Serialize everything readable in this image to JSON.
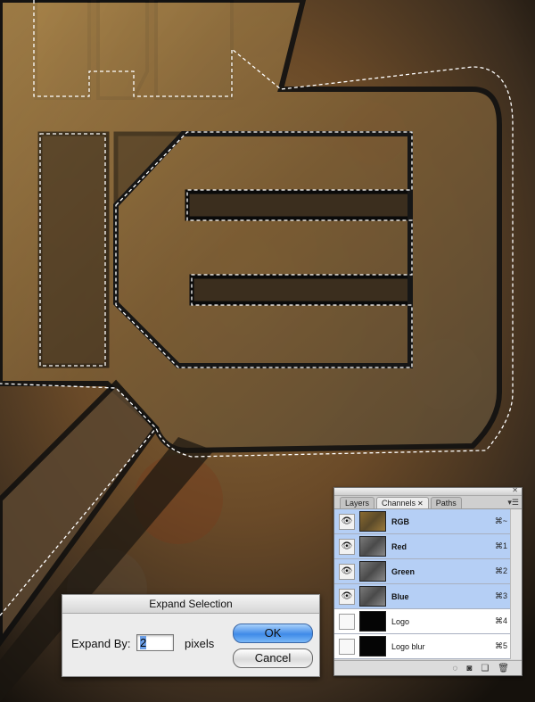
{
  "canvas": {
    "description_icon": "metal-logo-artwork"
  },
  "panel": {
    "tabs": [
      {
        "label": "Layers",
        "active": false
      },
      {
        "label": "Channels",
        "active": true
      },
      {
        "label": "Paths",
        "active": false
      }
    ],
    "channels": [
      {
        "name": "RGB",
        "shortcut": "⌘~",
        "visible": true,
        "selected": true,
        "thumb": "rgb"
      },
      {
        "name": "Red",
        "shortcut": "⌘1",
        "visible": true,
        "selected": true,
        "thumb": "gray"
      },
      {
        "name": "Green",
        "shortcut": "⌘2",
        "visible": true,
        "selected": true,
        "thumb": "gray"
      },
      {
        "name": "Blue",
        "shortcut": "⌘3",
        "visible": true,
        "selected": true,
        "thumb": "gray"
      },
      {
        "name": "Logo",
        "shortcut": "⌘4",
        "visible": false,
        "selected": false,
        "thumb": "logo"
      },
      {
        "name": "Logo blur",
        "shortcut": "⌘5",
        "visible": false,
        "selected": false,
        "thumb": "logo"
      }
    ],
    "bottom_icons": [
      "load-selection-icon",
      "save-selection-icon",
      "new-channel-icon",
      "trash-icon"
    ]
  },
  "dialog": {
    "title": "Expand Selection",
    "expand_label": "Expand By:",
    "expand_value": "2",
    "unit": "pixels",
    "ok_label": "OK",
    "cancel_label": "Cancel"
  },
  "colors": {
    "selection_blue": "#b5cff5",
    "ok_button": "#3f8ae8"
  }
}
